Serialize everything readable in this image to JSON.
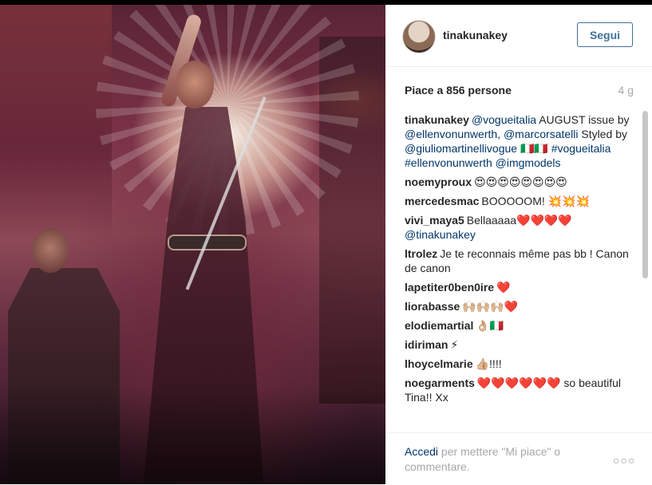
{
  "post": {
    "username": "tinakunakey",
    "follow_label": "Segui",
    "likes_text": "Piace a 856 persone",
    "time_ago": "4 g"
  },
  "caption": {
    "user": "tinakunakey",
    "parts": [
      {
        "text": "@vogueitalia",
        "tag": true
      },
      {
        "text": " AUGUST issue by ",
        "tag": false
      },
      {
        "text": "@ellenvonunwerth",
        "tag": true
      },
      {
        "text": ", ",
        "tag": false
      },
      {
        "text": "@marcorsatelli",
        "tag": true
      },
      {
        "text": " Styled by ",
        "tag": false
      },
      {
        "text": "@giuliomartinellivogue",
        "tag": true
      },
      {
        "text": " 🇮🇹🇮🇹 ",
        "tag": false
      },
      {
        "text": "#vogueitalia",
        "tag": true
      },
      {
        "text": " ",
        "tag": false
      },
      {
        "text": "#ellenvonunwerth",
        "tag": true
      },
      {
        "text": " ",
        "tag": false
      },
      {
        "text": "@imgmodels",
        "tag": true
      }
    ]
  },
  "comments": [
    {
      "user": "noemyproux",
      "parts": [
        {
          "text": "😍😍😍😍😍😍😍😍",
          "tag": false
        }
      ]
    },
    {
      "user": "mercedesmac",
      "parts": [
        {
          "text": "BOOOOOM! 💥💥💥",
          "tag": false
        }
      ]
    },
    {
      "user": "vivi_maya5",
      "parts": [
        {
          "text": "Bellaaaaa❤️❤️❤️❤️ ",
          "tag": false
        },
        {
          "text": "@tinakunakey",
          "tag": true
        }
      ]
    },
    {
      "user": "ltrolez",
      "parts": [
        {
          "text": "Je te reconnais même pas bb ! Canon de canon",
          "tag": false
        }
      ]
    },
    {
      "user": "lapetiter0ben0ire",
      "parts": [
        {
          "text": "❤️",
          "tag": false
        }
      ]
    },
    {
      "user": "liorabasse",
      "parts": [
        {
          "text": "🙌🏼🙌🏼🙌🏼❤️",
          "tag": false
        }
      ]
    },
    {
      "user": "elodiemartial",
      "parts": [
        {
          "text": "👌🏼🇮🇹",
          "tag": false
        }
      ]
    },
    {
      "user": "idiriman",
      "parts": [
        {
          "text": "⚡",
          "tag": false
        }
      ]
    },
    {
      "user": "lhoycelmarie",
      "parts": [
        {
          "text": "👍🏼!!!!",
          "tag": false
        }
      ]
    },
    {
      "user": "noegarments",
      "parts": [
        {
          "text": "❤️❤️❤️❤️❤️❤️ so beautiful Tina!! Xx",
          "tag": false
        }
      ]
    }
  ],
  "footer": {
    "login_link": "Accedi",
    "login_rest": " per mettere \"Mi piace\" o commentare.",
    "more_label": "○○○"
  }
}
